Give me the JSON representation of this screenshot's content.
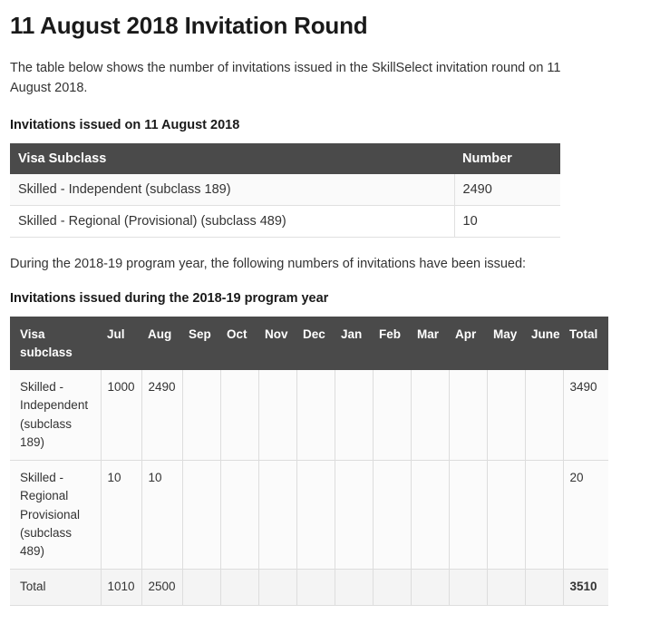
{
  "page": {
    "title": "11 August 2018 Invitation Round",
    "intro_paragraph": "The table below shows the number of invitations issued in the SkillSelect invitation round on 11 August 2018.",
    "section_one_heading": "Invitations issued on 11 August 2018",
    "mid_paragraph": "During the 2018-19 program year, the following numbers of invitations have been issued:",
    "section_two_heading": "Invitations issued during the 2018-19 program year"
  },
  "colors": {
    "table_header_bg": "#4a4a4a",
    "table_header_text": "#ffffff",
    "body_text": "#333333",
    "row_border": "#e0e0e0",
    "total_row_bg": "#f4f4f4",
    "page_bg": "#ffffff"
  },
  "table_round": {
    "columns": [
      "Visa Subclass",
      "Number"
    ],
    "rows": [
      {
        "subclass": "Skilled - Independent (subclass 189)",
        "number": "2490"
      },
      {
        "subclass": "Skilled - Regional (Provisional) (subclass 489)",
        "number": "10"
      }
    ]
  },
  "table_program_year": {
    "columns": [
      "Visa subclass",
      "Jul",
      "Aug",
      "Sep",
      "Oct",
      "Nov",
      "Dec",
      "Jan",
      "Feb",
      "Mar",
      "Apr",
      "May",
      "June",
      "Total"
    ],
    "rows": [
      {
        "subclass": "Skilled - Independent (subclass 189)",
        "values": [
          "1000",
          "2490",
          "",
          "",
          "",
          "",
          "",
          "",
          "",
          "",
          "",
          ""
        ],
        "total": "3490"
      },
      {
        "subclass": "Skilled - Regional Provisional (subclass 489)",
        "values": [
          "10",
          "10",
          "",
          "",
          "",
          "",
          "",
          "",
          "",
          "",
          "",
          ""
        ],
        "total": "20"
      }
    ],
    "total_row": {
      "label": "Total",
      "values": [
        "1010",
        "2500",
        "",
        "",
        "",
        "",
        "",
        "",
        "",
        "",
        "",
        ""
      ],
      "total": "3510"
    }
  },
  "chart_data": {
    "type": "table",
    "title": "Invitations issued during the 2018-19 program year",
    "categories": [
      "Jul",
      "Aug",
      "Sep",
      "Oct",
      "Nov",
      "Dec",
      "Jan",
      "Feb",
      "Mar",
      "Apr",
      "May",
      "June"
    ],
    "series": [
      {
        "name": "Skilled - Independent (subclass 189)",
        "values": [
          1000,
          2490,
          null,
          null,
          null,
          null,
          null,
          null,
          null,
          null,
          null,
          null
        ],
        "total": 3490
      },
      {
        "name": "Skilled - Regional Provisional (subclass 489)",
        "values": [
          10,
          10,
          null,
          null,
          null,
          null,
          null,
          null,
          null,
          null,
          null,
          null
        ],
        "total": 20
      }
    ],
    "column_totals": [
      1010,
      2500,
      null,
      null,
      null,
      null,
      null,
      null,
      null,
      null,
      null,
      null
    ],
    "grand_total": 3510,
    "round_snapshot": {
      "date": "11 August 2018",
      "categories": [
        "Skilled - Independent (subclass 189)",
        "Skilled - Regional (Provisional) (subclass 489)"
      ],
      "values": [
        2490,
        10
      ]
    }
  }
}
